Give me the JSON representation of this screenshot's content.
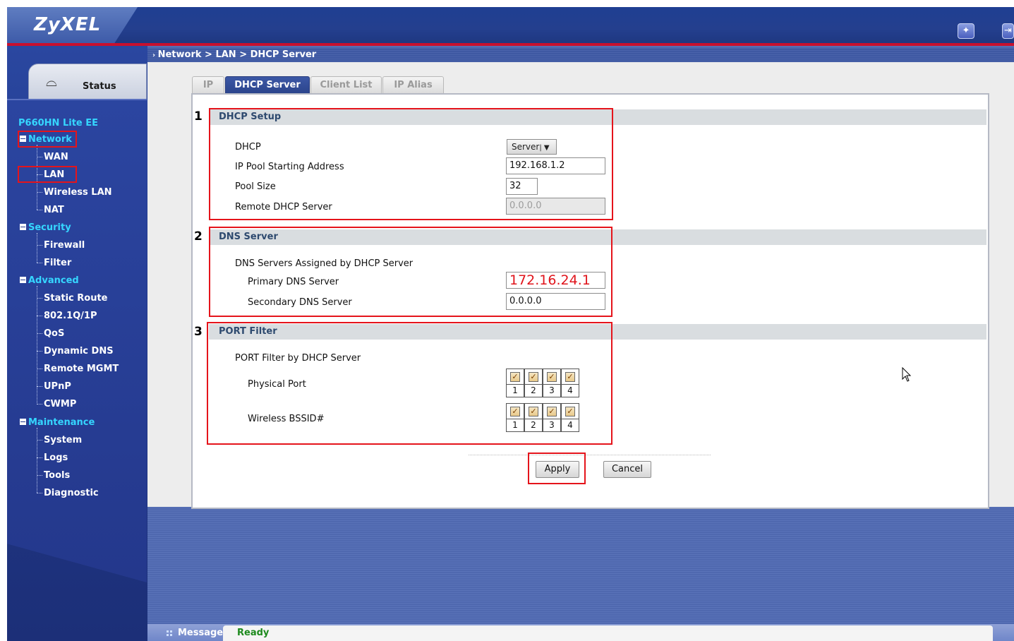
{
  "header": {
    "logo": "ZyXEL"
  },
  "breadcrumb": "Network > LAN > DHCP Server",
  "sidebar": {
    "status_label": "Status",
    "model": "P660HN Lite EE",
    "groups": [
      {
        "label": "Network",
        "items": [
          "WAN",
          "LAN",
          "Wireless LAN",
          "NAT"
        ]
      },
      {
        "label": "Security",
        "items": [
          "Firewall",
          "Filter"
        ]
      },
      {
        "label": "Advanced",
        "items": [
          "Static Route",
          "802.1Q/1P",
          "QoS",
          "Dynamic DNS",
          "Remote MGMT",
          "UPnP",
          "CWMP"
        ]
      },
      {
        "label": "Maintenance",
        "items": [
          "System",
          "Logs",
          "Tools",
          "Diagnostic"
        ]
      }
    ]
  },
  "tabs": [
    "IP",
    "DHCP Server",
    "Client List",
    "IP Alias"
  ],
  "sections": {
    "dhcp_setup": {
      "number": "1",
      "title": "DHCP Setup",
      "dhcp_label": "DHCP",
      "dhcp_value": "Server",
      "pool_start_label": "IP Pool Starting Address",
      "pool_start_value": "192.168.1.2",
      "pool_size_label": "Pool Size",
      "pool_size_value": "32",
      "remote_label": "Remote DHCP Server",
      "remote_value": "0.0.0.0"
    },
    "dns_server": {
      "number": "2",
      "title": "DNS Server",
      "assigned_label": "DNS Servers Assigned by DHCP Server",
      "primary_label": "Primary DNS Server",
      "primary_value": "172.16.24.1",
      "secondary_label": "Secondary DNS Server",
      "secondary_value": "0.0.0.0"
    },
    "port_filter": {
      "number": "3",
      "title": "PORT Filter",
      "filter_label": "PORT Filter by DHCP Server",
      "physical_label": "Physical Port",
      "wireless_label": "Wireless BSSID#",
      "ports": [
        "1",
        "2",
        "3",
        "4"
      ]
    }
  },
  "buttons": {
    "apply": "Apply",
    "cancel": "Cancel"
  },
  "message": {
    "label": "Message",
    "text": "Ready"
  },
  "colors": {
    "accent_blue": "#243f8e",
    "highlight_red": "#e5141b",
    "link_cyan": "#35d6ff",
    "status_green": "#1d8a1d"
  }
}
